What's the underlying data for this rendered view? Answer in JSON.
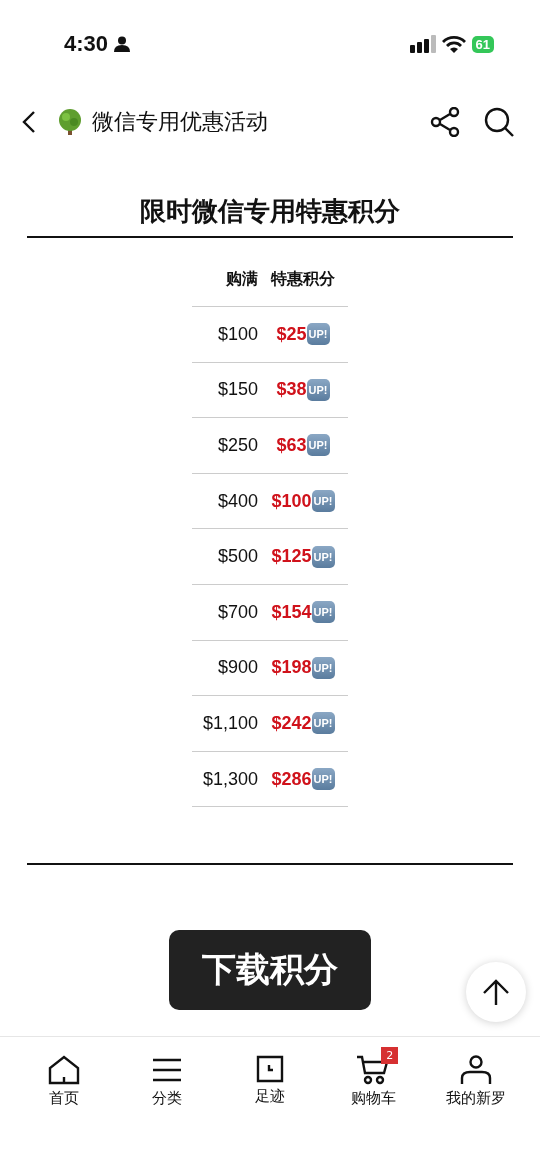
{
  "status_bar": {
    "time": "4:30",
    "battery": "61"
  },
  "header": {
    "title": "微信专用优惠活动"
  },
  "page_title": "限时微信专用特惠积分",
  "table": {
    "columns": [
      "购满",
      "特惠积分"
    ],
    "rows": [
      {
        "spend": "$100",
        "points": "$25",
        "badge": "UP!"
      },
      {
        "spend": "$150",
        "points": "$38",
        "badge": "UP!"
      },
      {
        "spend": "$250",
        "points": "$63",
        "badge": "UP!"
      },
      {
        "spend": "$400",
        "points": "$100",
        "badge": "UP!"
      },
      {
        "spend": "$500",
        "points": "$125",
        "badge": "UP!"
      },
      {
        "spend": "$700",
        "points": "$154",
        "badge": "UP!"
      },
      {
        "spend": "$900",
        "points": "$198",
        "badge": "UP!"
      },
      {
        "spend": "$1,100",
        "points": "$242",
        "badge": "UP!"
      },
      {
        "spend": "$1,300",
        "points": "$286",
        "badge": "UP!"
      }
    ]
  },
  "download_button": "下载积分",
  "tab_bar": [
    {
      "kind": "home",
      "label": "首页"
    },
    {
      "kind": "menu",
      "label": "分类"
    },
    {
      "kind": "history",
      "label": "足迹"
    },
    {
      "kind": "cart",
      "label": "购物车",
      "badge": "2"
    },
    {
      "kind": "profile",
      "label": "我的新罗"
    }
  ]
}
